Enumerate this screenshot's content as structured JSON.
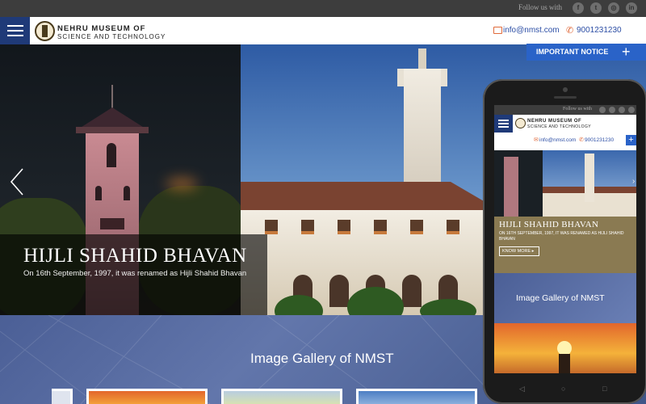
{
  "topbar": {
    "follow_label": "Follow us with",
    "social": [
      {
        "icon": "facebook-icon",
        "glyph": "f"
      },
      {
        "icon": "twitter-icon",
        "glyph": "t"
      },
      {
        "icon": "instagram-icon",
        "glyph": "◎"
      },
      {
        "icon": "linkedin-icon",
        "glyph": "in"
      }
    ]
  },
  "header": {
    "brand_line1": "NEHRU MUSEUM OF",
    "brand_line2": "SCIENCE AND TECHNOLOGY",
    "email": "info@nmst.com",
    "phone": "9001231230"
  },
  "notice": {
    "label": "IMPORTANT NOTICE",
    "plus": "+"
  },
  "hero": {
    "title": "HIJLI SHAHID BHAVAN",
    "subtitle": "On 16th September, 1997, it was renamed as Hijli Shahid Bhavan"
  },
  "gallery": {
    "title": "Image Gallery of NMST"
  },
  "mobile": {
    "follow_label": "Follow us with",
    "brand_line1": "NEHRU MUSEUM OF",
    "brand_line2": "SCIENCE AND TECHNOLOGY",
    "email": "info@nmst.com",
    "phone": "9001231230",
    "plus": "+",
    "title": "HIJLI SHAHID BHAVAN",
    "subtitle": "ON 16TH SEPTEMBER, 1997, IT WAS RENAMED AS HIJLI SHAHID BHAVAN",
    "more_label": "KNOW MORE ▸",
    "gallery_title": "Image Gallery of NMST"
  },
  "colors": {
    "primary_blue": "#1f3a78",
    "notice_blue": "#2a63c8",
    "accent_orange": "#e06a3b",
    "link_blue": "#2c4ea5"
  }
}
